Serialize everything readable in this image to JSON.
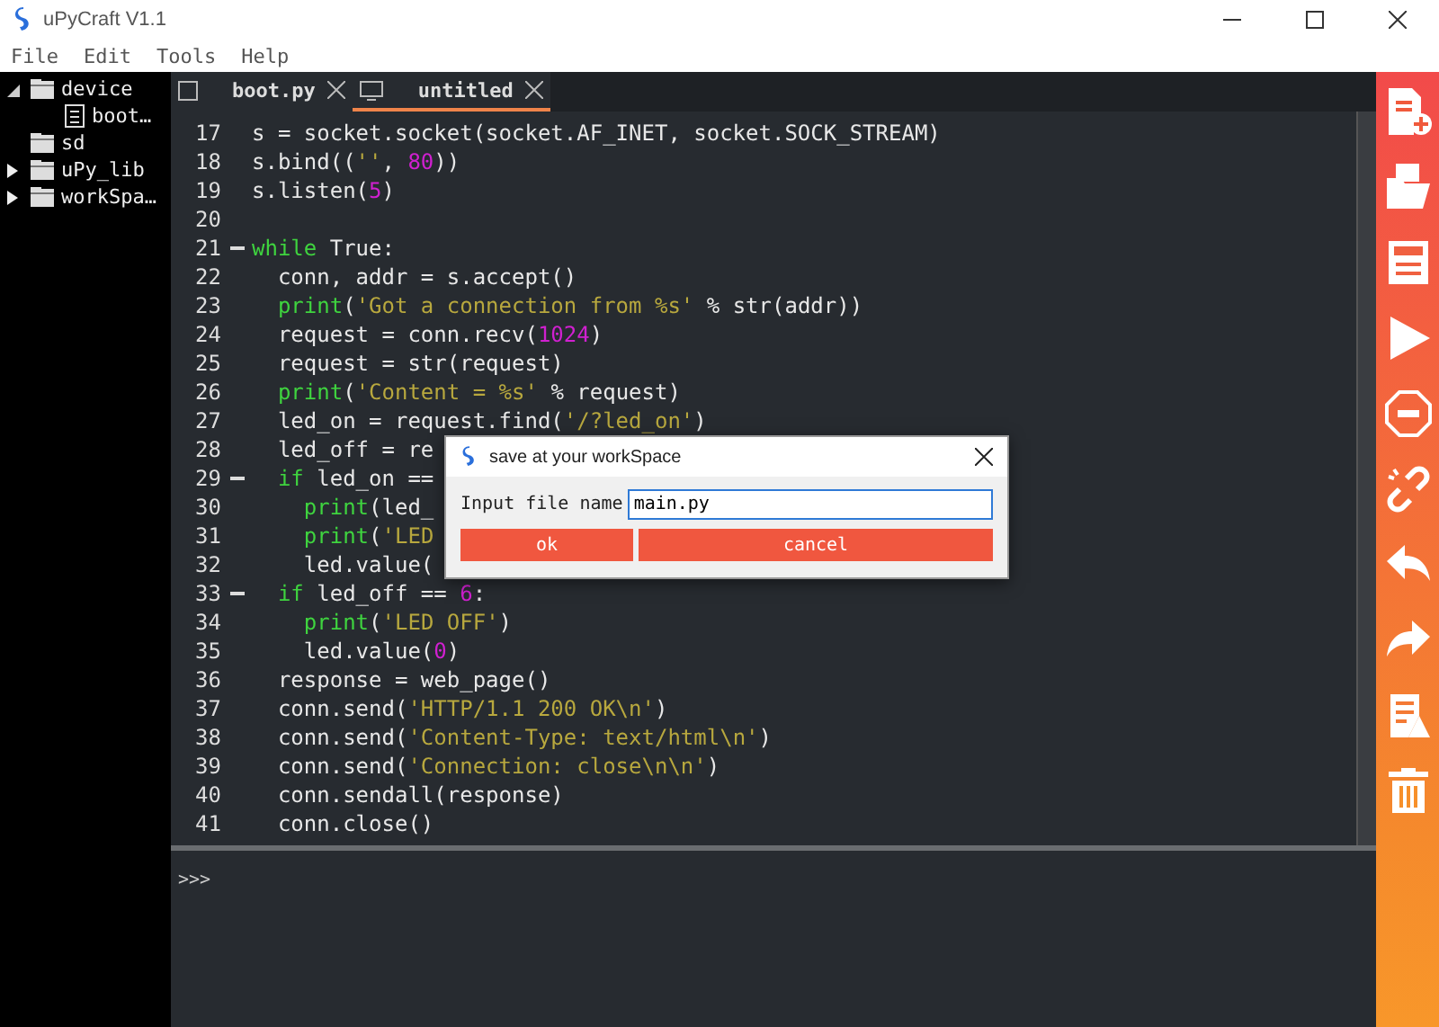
{
  "window": {
    "title": "uPyCraft V1.1"
  },
  "menu": [
    "File",
    "Edit",
    "Tools",
    "Help"
  ],
  "tree": [
    {
      "label": "device",
      "expanded": true,
      "kind": "folder",
      "children": [
        {
          "label": "boot…",
          "kind": "file"
        }
      ]
    },
    {
      "label": "sd",
      "kind": "folder"
    },
    {
      "label": "uPy_lib",
      "kind": "folder",
      "expanded": false
    },
    {
      "label": "workSpa…",
      "kind": "folder",
      "expanded": false
    }
  ],
  "tabs": [
    {
      "label": "boot.py",
      "kind": "file",
      "selected": false
    },
    {
      "label": "untitled",
      "kind": "monitor",
      "selected": true
    }
  ],
  "editor": {
    "lines": [
      {
        "number": "17",
        "fold": false,
        "segments": [
          {
            "kind": "plain",
            "text": "s = socket.socket(socket.AF_INET, socket.SOCK_STREAM)"
          }
        ]
      },
      {
        "number": "18",
        "fold": false,
        "segments": [
          {
            "kind": "plain",
            "text": "s.bind(("
          },
          {
            "kind": "string",
            "text": "''"
          },
          {
            "kind": "plain",
            "text": ", "
          },
          {
            "kind": "number",
            "text": "80"
          },
          {
            "kind": "plain",
            "text": "))"
          }
        ]
      },
      {
        "number": "19",
        "fold": false,
        "segments": [
          {
            "kind": "plain",
            "text": "s.listen("
          },
          {
            "kind": "number",
            "text": "5"
          },
          {
            "kind": "plain",
            "text": ")"
          }
        ]
      },
      {
        "number": "20",
        "fold": false
      },
      {
        "number": "21",
        "fold": true,
        "segments": [
          {
            "kind": "keyword",
            "text": "while"
          },
          {
            "kind": "plain",
            "text": " True:"
          }
        ]
      },
      {
        "number": "22",
        "fold": false,
        "segments": [
          {
            "kind": "plain",
            "text": "  conn, addr = s.accept()"
          }
        ]
      },
      {
        "number": "23",
        "fold": false,
        "segments": [
          {
            "kind": "keyword",
            "text": "  print"
          },
          {
            "kind": "plain",
            "text": "("
          },
          {
            "kind": "string",
            "text": "'Got a connection from %s'"
          },
          {
            "kind": "plain",
            "text": " % str(addr))"
          }
        ]
      },
      {
        "number": "24",
        "fold": false,
        "segments": [
          {
            "kind": "plain",
            "text": "  request = conn.recv("
          },
          {
            "kind": "number",
            "text": "1024"
          },
          {
            "kind": "plain",
            "text": ")"
          }
        ]
      },
      {
        "number": "25",
        "fold": false,
        "segments": [
          {
            "kind": "plain",
            "text": "  request = str(request)"
          }
        ]
      },
      {
        "number": "26",
        "fold": false,
        "segments": [
          {
            "kind": "keyword",
            "text": "  print"
          },
          {
            "kind": "plain",
            "text": "("
          },
          {
            "kind": "string",
            "text": "'Content = %s'"
          },
          {
            "kind": "plain",
            "text": " % request)"
          }
        ]
      },
      {
        "number": "27",
        "fold": false,
        "segments": [
          {
            "kind": "plain",
            "text": "  led_on = request.find("
          },
          {
            "kind": "string",
            "text": "'/?led_on'"
          },
          {
            "kind": "plain",
            "text": ")"
          }
        ]
      },
      {
        "number": "28",
        "fold": false,
        "segments": [
          {
            "kind": "plain",
            "text": "  led_off = re"
          }
        ]
      },
      {
        "number": "29",
        "fold": true,
        "segments": [
          {
            "kind": "keyword",
            "text": "  if"
          },
          {
            "kind": "plain",
            "text": " led_on =="
          }
        ]
      },
      {
        "number": "30",
        "fold": false,
        "segments": [
          {
            "kind": "keyword",
            "text": "    print"
          },
          {
            "kind": "plain",
            "text": "(led_"
          }
        ]
      },
      {
        "number": "31",
        "fold": false,
        "segments": [
          {
            "kind": "keyword",
            "text": "    print"
          },
          {
            "kind": "plain",
            "text": "("
          },
          {
            "kind": "string",
            "text": "'LED"
          }
        ]
      },
      {
        "number": "32",
        "fold": false,
        "segments": [
          {
            "kind": "plain",
            "text": "    led.value("
          }
        ]
      },
      {
        "number": "33",
        "fold": true,
        "segments": [
          {
            "kind": "keyword",
            "text": "  if"
          },
          {
            "kind": "plain",
            "text": " led_off == "
          },
          {
            "kind": "number",
            "text": "6"
          },
          {
            "kind": "plain",
            "text": ":"
          }
        ]
      },
      {
        "number": "34",
        "fold": false,
        "segments": [
          {
            "kind": "keyword",
            "text": "    print"
          },
          {
            "kind": "plain",
            "text": "("
          },
          {
            "kind": "string",
            "text": "'LED OFF'"
          },
          {
            "kind": "plain",
            "text": ")"
          }
        ]
      },
      {
        "number": "35",
        "fold": false,
        "segments": [
          {
            "kind": "plain",
            "text": "    led.value("
          },
          {
            "kind": "number",
            "text": "0"
          },
          {
            "kind": "plain",
            "text": ")"
          }
        ]
      },
      {
        "number": "36",
        "fold": false,
        "segments": [
          {
            "kind": "plain",
            "text": "  response = web_page()"
          }
        ]
      },
      {
        "number": "37",
        "fold": false,
        "segments": [
          {
            "kind": "plain",
            "text": "  conn.send("
          },
          {
            "kind": "string",
            "text": "'HTTP/1.1 200 OK\\n'"
          },
          {
            "kind": "plain",
            "text": ")"
          }
        ]
      },
      {
        "number": "38",
        "fold": false,
        "segments": [
          {
            "kind": "plain",
            "text": "  conn.send("
          },
          {
            "kind": "string",
            "text": "'Content-Type: text/html\\n'"
          },
          {
            "kind": "plain",
            "text": ")"
          }
        ]
      },
      {
        "number": "39",
        "fold": false,
        "segments": [
          {
            "kind": "plain",
            "text": "  conn.send("
          },
          {
            "kind": "string",
            "text": "'Connection: close\\n\\n'"
          },
          {
            "kind": "plain",
            "text": ")"
          }
        ]
      },
      {
        "number": "40",
        "fold": false,
        "segments": [
          {
            "kind": "plain",
            "text": "  conn.sendall(response)"
          }
        ]
      },
      {
        "number": "41",
        "fold": false,
        "segments": [
          {
            "kind": "plain",
            "text": "  conn.close()"
          }
        ]
      }
    ]
  },
  "shell": {
    "prompt": ">>>"
  },
  "dialog": {
    "title": "save at your workSpace",
    "label": "Input file name",
    "value": "main.py",
    "buttons": [
      "ok",
      "cancel"
    ]
  },
  "toolbar": [
    {
      "kind": "new"
    },
    {
      "kind": "open"
    },
    {
      "kind": "save"
    },
    {
      "kind": "run"
    },
    {
      "kind": "stop"
    },
    {
      "kind": "connect"
    },
    {
      "kind": "undo"
    },
    {
      "kind": "redo"
    },
    {
      "kind": "check"
    },
    {
      "kind": "delete"
    }
  ]
}
